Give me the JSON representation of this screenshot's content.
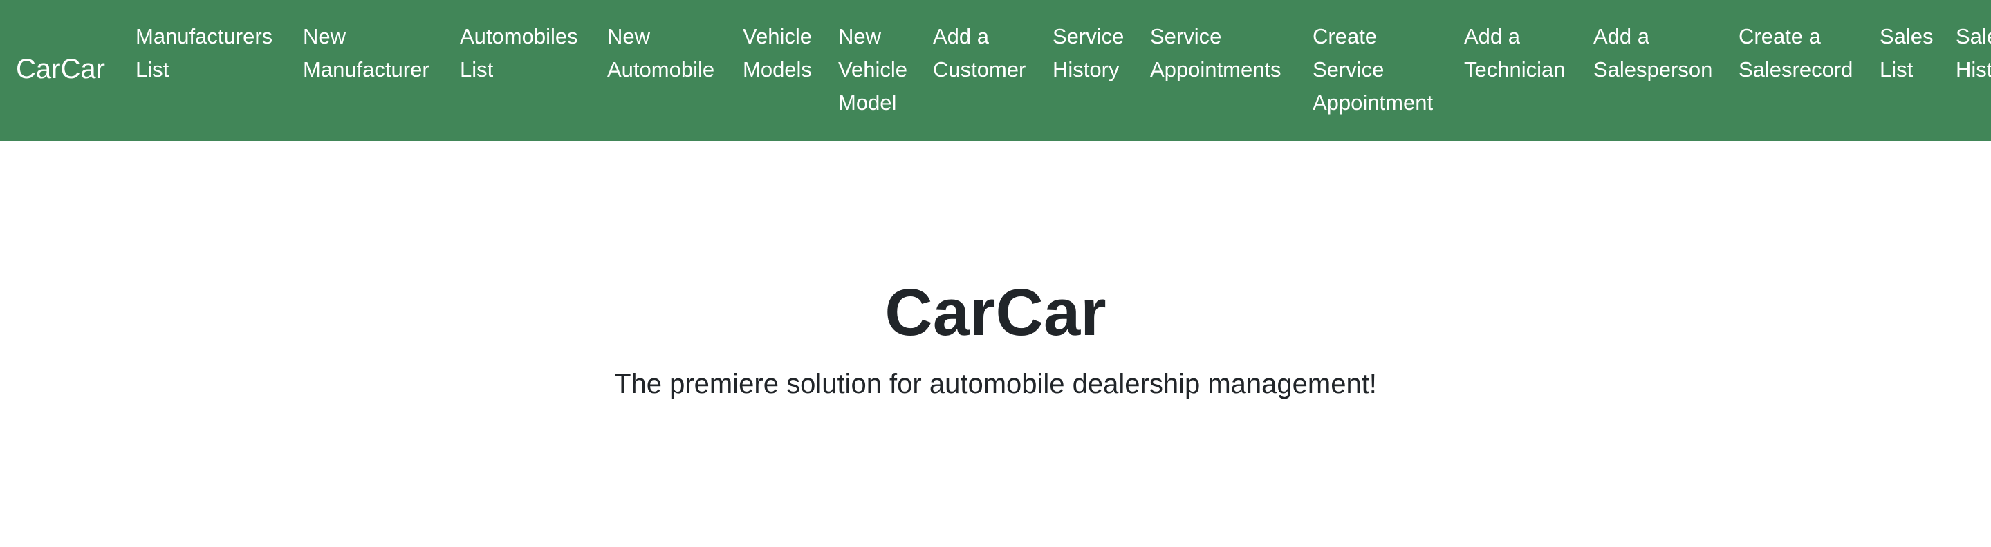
{
  "navbar": {
    "brand": "CarCar",
    "background_color": "#418658",
    "link_color": "#ffffff",
    "items": [
      {
        "label": "Manufacturers\nList"
      },
      {
        "label": "New\nManufacturer"
      },
      {
        "label": "Automobiles\nList"
      },
      {
        "label": "New\nAutomobile"
      },
      {
        "label": "Vehicle\nModels"
      },
      {
        "label": "New\nVehicle\nModel"
      },
      {
        "label": "Add a\nCustomer"
      },
      {
        "label": "Service\nHistory"
      },
      {
        "label": "Service\nAppointments"
      },
      {
        "label": "Create\nService\nAppointment"
      },
      {
        "label": "Add a\nTechnician"
      },
      {
        "label": "Add a\nSalesperson"
      },
      {
        "label": "Create a\nSalesrecord"
      },
      {
        "label": "Sales\nList"
      },
      {
        "label": "Sales\nHistory"
      }
    ]
  },
  "hero": {
    "title": "CarCar",
    "lead": "The premiere solution for automobile dealership management!",
    "text_color": "#212529"
  }
}
